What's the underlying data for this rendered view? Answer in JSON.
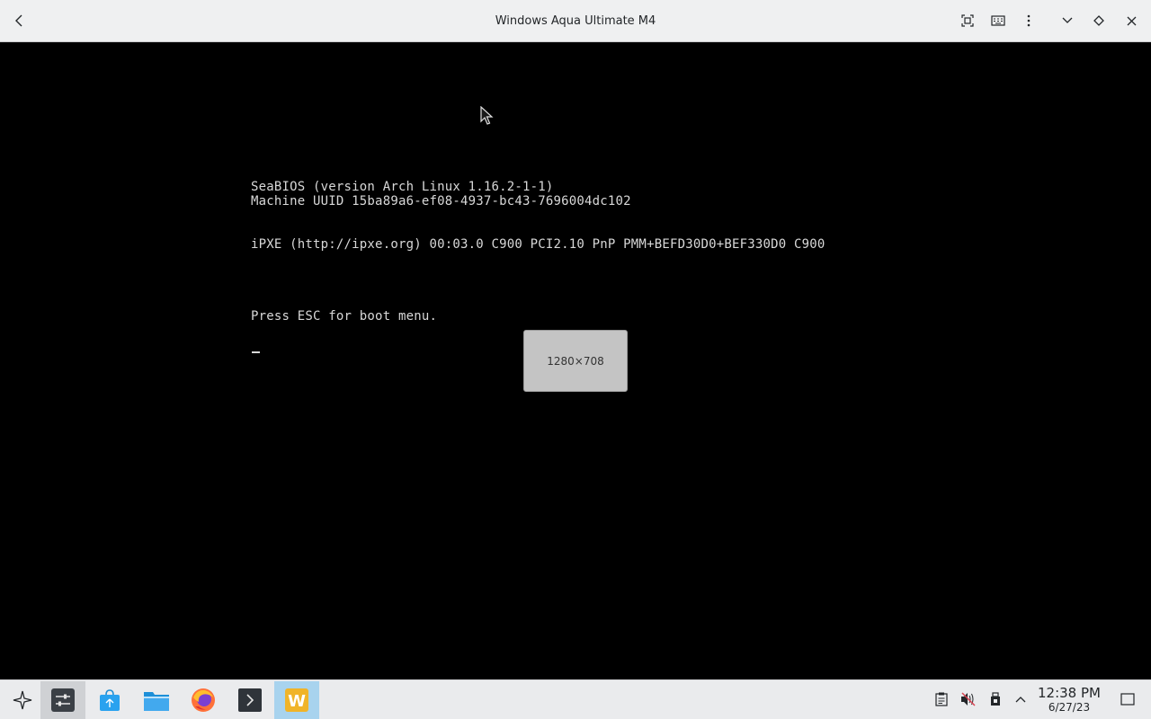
{
  "window": {
    "title": "Windows Aqua Ultimate M4"
  },
  "toolbar_icons": [
    "back-arrow-icon",
    "fullscreen-icon",
    "keyboard-icon",
    "kebab-menu-icon",
    "minimize-chevron-icon",
    "diamond-icon",
    "close-icon"
  ],
  "vm_console": {
    "lines": [
      "SeaBIOS (version Arch Linux 1.16.2-1-1)",
      "Machine UUID 15ba89a6-ef08-4937-bc43-7696004dc102",
      "iPXE (http://ipxe.org) 00:03.0 C900 PCI2.10 PnP PMM+BEFD30D0+BEF330D0 C900",
      "Press ESC for boot menu."
    ],
    "resolution_osd": "1280×708",
    "text_color": "#d8d8d8",
    "background": "#000000"
  },
  "taskbar": {
    "apps": [
      {
        "name": "app-launcher",
        "icon": "launcher-icon"
      },
      {
        "name": "system-settings",
        "icon": "settings-sliders-icon"
      },
      {
        "name": "discover",
        "icon": "store-bag-icon"
      },
      {
        "name": "file-manager",
        "icon": "folder-icon"
      },
      {
        "name": "firefox",
        "icon": "firefox-icon"
      },
      {
        "name": "terminal",
        "icon": "terminal-icon"
      },
      {
        "name": "w-app",
        "icon": "w-logo-icon",
        "label": "W"
      }
    ],
    "tray": [
      "clipboard-icon",
      "volume-muted-icon",
      "usb-device-icon",
      "chevron-up-icon"
    ],
    "clock": {
      "time": "12:38 PM",
      "date": "6/27/23"
    }
  }
}
